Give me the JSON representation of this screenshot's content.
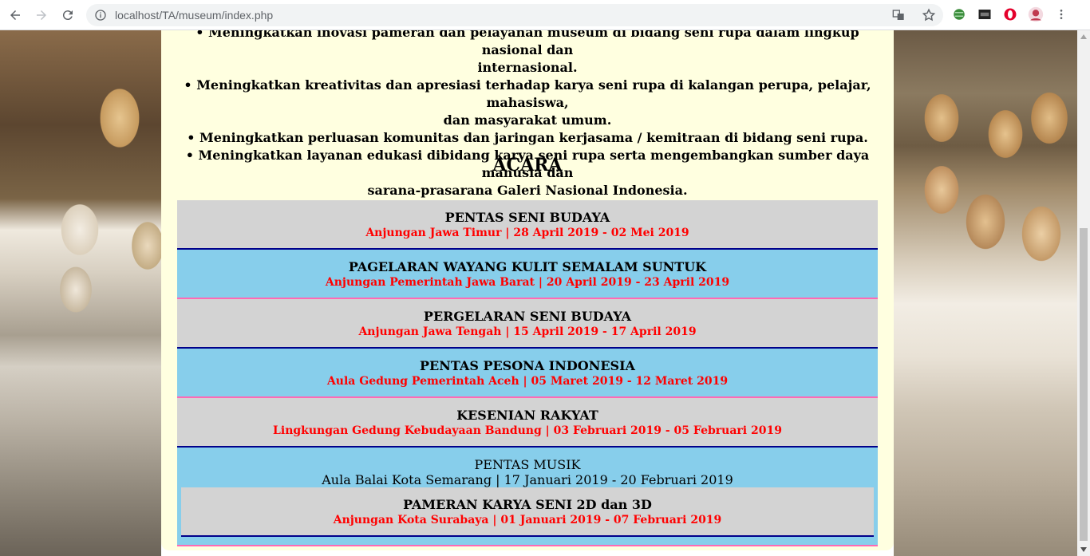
{
  "browser": {
    "url": "localhost/TA/museum/index.php"
  },
  "page": {
    "missions": [
      "• Meningkatkan inovasi pameran dan pelayanan museum di bidang seni rupa dalam lingkup nasional dan",
      "internasional.",
      "• Meningkatkan kreativitas dan apresiasi terhadap karya seni rupa di kalangan perupa, pelajar, mahasiswa,",
      "dan masyarakat umum.",
      "• Meningkatkan perluasan komunitas dan jaringan kerjasama / kemitraan di bidang seni rupa.",
      "• Meningkatkan layanan edukasi dibidang karya seni rupa serta mengembangkan sumber daya manusia dan",
      "sarana-prasarana Galeri Nasional Indonesia."
    ],
    "acara_title": "ACARA",
    "events": [
      {
        "name": "PENTAS SENI BUDAYA",
        "meta": "Anjungan Jawa Timur | 28 April 2019 - 02 Mei 2019"
      },
      {
        "name": "PAGELARAN WAYANG KULIT SEMALAM SUNTUK",
        "meta": "Anjungan Pemerintah Jawa Barat | 20 April 2019 - 23 April 2019"
      },
      {
        "name": "PERGELARAN SENI BUDAYA",
        "meta": "Anjungan Jawa Tengah | 15 April 2019 - 17 April 2019"
      },
      {
        "name": "PENTAS PESONA INDONESIA",
        "meta": "Aula Gedung Pemerintah Aceh | 05 Maret 2019 - 12 Maret 2019"
      },
      {
        "name": "KESENIAN RAKYAT",
        "meta": "Lingkungan Gedung Kebudayaan Bandung | 03 Februari 2019 - 05 Februari 2019"
      },
      {
        "name": "PENTAS MUSIK",
        "meta": "Aula Balai Kota Semarang | 17 Januari 2019 - 20 Februari 2019"
      },
      {
        "name": "PAMERAN KARYA SENI 2D dan 3D",
        "meta": "Anjungan Kota Surabaya | 01 Januari 2019 - 07 Februari 2019"
      }
    ]
  },
  "colors": {
    "content_bg": "#ffffe0",
    "event_gray": "#d3d3d3",
    "event_blue": "#87ceeb",
    "meta_text": "#ff0000",
    "border_navy": "#00008b",
    "border_pink": "#ff69b4"
  }
}
